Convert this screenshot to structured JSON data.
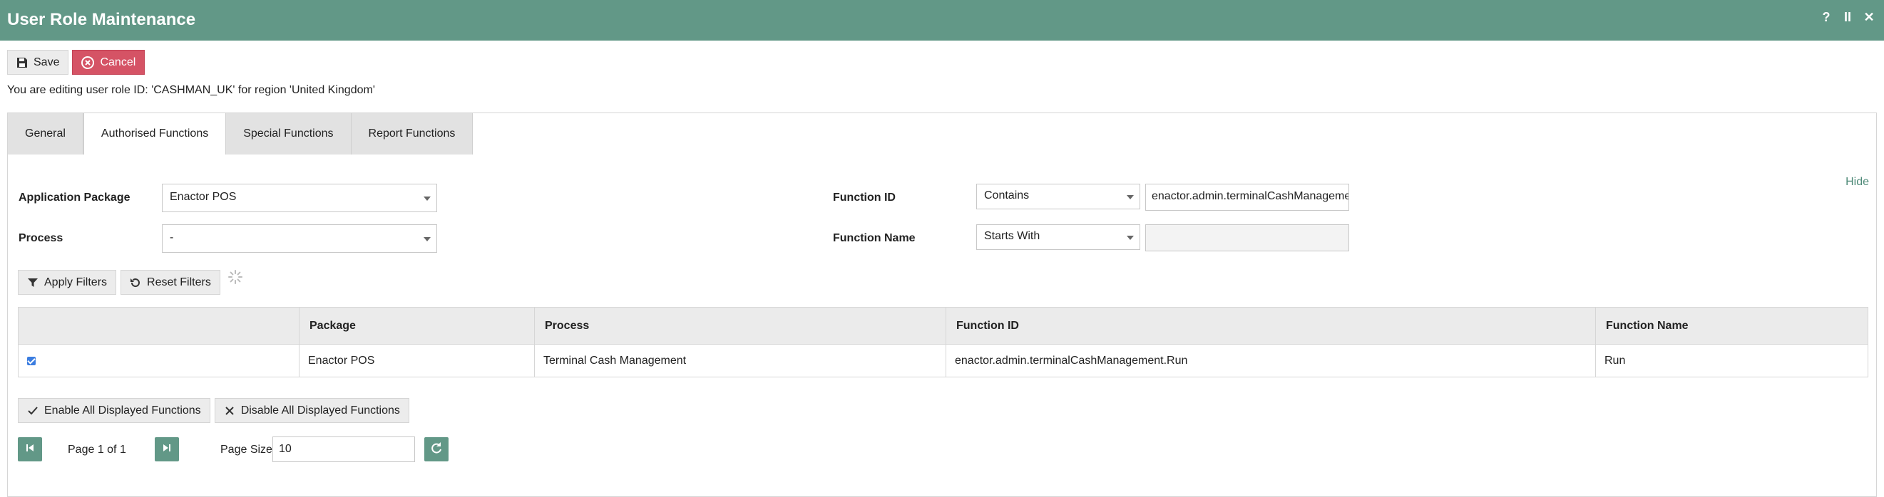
{
  "window": {
    "title": "User Role Maintenance",
    "help_glyph": "?",
    "pause_glyph": "II",
    "close_glyph": "✕"
  },
  "toolbar": {
    "save_label": "Save",
    "cancel_label": "Cancel"
  },
  "edit_info": "You are editing user role ID: 'CASHMAN_UK' for region 'United Kingdom'",
  "tabs": [
    {
      "label": "General",
      "active": false
    },
    {
      "label": "Authorised Functions",
      "active": true
    },
    {
      "label": "Special Functions",
      "active": false
    },
    {
      "label": "Report Functions",
      "active": false
    }
  ],
  "filters": {
    "hide_label": "Hide",
    "application_package": {
      "label": "Application Package",
      "value": "Enactor POS"
    },
    "process": {
      "label": "Process",
      "value": "-"
    },
    "function_id": {
      "label": "Function ID",
      "operator": "Contains",
      "value": "enactor.admin.terminalCashManagement.Run"
    },
    "function_name": {
      "label": "Function Name",
      "operator": "Starts With",
      "value": ""
    },
    "apply_label": "Apply Filters",
    "reset_label": "Reset Filters"
  },
  "table": {
    "columns": [
      "",
      "Package",
      "Process",
      "Function ID",
      "Function Name"
    ],
    "rows": [
      {
        "checked": true,
        "package": "Enactor POS",
        "process": "Terminal Cash Management",
        "function_id": "enactor.admin.terminalCashManagement.Run",
        "function_name": "Run"
      }
    ]
  },
  "bulk": {
    "enable_label": "Enable All Displayed Functions",
    "disable_label": "Disable All Displayed Functions"
  },
  "pager": {
    "page_text": "Page 1 of 1",
    "page_size_label": "Page Size",
    "page_size_value": "10"
  },
  "colors": {
    "header": "#629887",
    "cancel": "#d55365",
    "link": "#4e8a78"
  }
}
